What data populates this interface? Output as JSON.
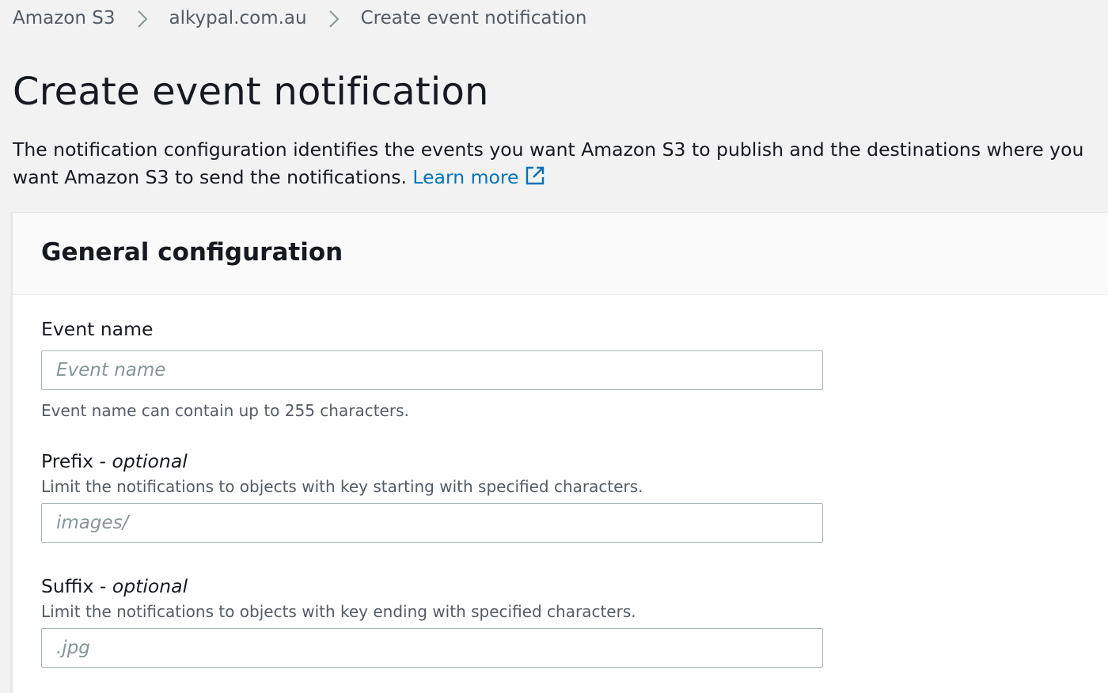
{
  "breadcrumb": {
    "items": [
      "Amazon S3",
      "alkypal.com.au"
    ],
    "current": "Create event notification"
  },
  "page": {
    "title": "Create event notification",
    "description": "The notification configuration identifies the events you want Amazon S3 to publish and the destinations where you want Amazon S3 to send the notifications.",
    "learn_more": "Learn more"
  },
  "general_config": {
    "title": "General configuration",
    "event_name": {
      "label": "Event name",
      "placeholder": "Event name",
      "value": "",
      "hint": "Event name can contain up to 255 characters."
    },
    "prefix": {
      "label": "Prefix -",
      "optional": "optional",
      "description": "Limit the notifications to objects with key starting with specified characters.",
      "placeholder": "images/",
      "value": ""
    },
    "suffix": {
      "label": "Suffix -",
      "optional": "optional",
      "description": "Limit the notifications to objects with key ending with specified characters.",
      "placeholder": ".jpg",
      "value": ""
    }
  },
  "colors": {
    "link": "#0073bb",
    "text": "#16191f",
    "muted": "#545b64",
    "background": "#f2f2f2"
  },
  "icons": {
    "breadcrumb_separator": "chevron-right-icon",
    "learn_more": "external-link-icon"
  }
}
